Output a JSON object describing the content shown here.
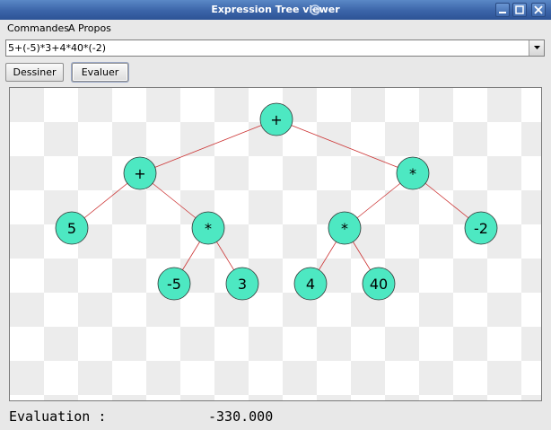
{
  "window": {
    "title": "Expression Tree viewer"
  },
  "menu": {
    "items": [
      "Commandes",
      "A Propos"
    ]
  },
  "expression": {
    "value": "5+(-5)*3+4*40*(-2)"
  },
  "buttons": {
    "draw": "Dessiner",
    "evaluate": "Evaluer"
  },
  "tree": {
    "nodes": [
      {
        "id": "n1",
        "label": "+"
      },
      {
        "id": "n2",
        "label": "+"
      },
      {
        "id": "n3",
        "label": "*"
      },
      {
        "id": "n4",
        "label": "5"
      },
      {
        "id": "n5",
        "label": "*"
      },
      {
        "id": "n6",
        "label": "*"
      },
      {
        "id": "n7",
        "label": "-2"
      },
      {
        "id": "n8",
        "label": "-5"
      },
      {
        "id": "n9",
        "label": "3"
      },
      {
        "id": "n10",
        "label": "4"
      },
      {
        "id": "n11",
        "label": "40"
      }
    ],
    "edges": [
      [
        "n1",
        "n2"
      ],
      [
        "n1",
        "n3"
      ],
      [
        "n2",
        "n4"
      ],
      [
        "n2",
        "n5"
      ],
      [
        "n3",
        "n6"
      ],
      [
        "n3",
        "n7"
      ],
      [
        "n5",
        "n8"
      ],
      [
        "n5",
        "n9"
      ],
      [
        "n6",
        "n10"
      ],
      [
        "n6",
        "n11"
      ]
    ],
    "node_color": "#4de8c2",
    "edge_color": "#cc3333",
    "checker_color": "#ececec"
  },
  "status": {
    "label": "Evaluation :",
    "value": "-330.000"
  }
}
